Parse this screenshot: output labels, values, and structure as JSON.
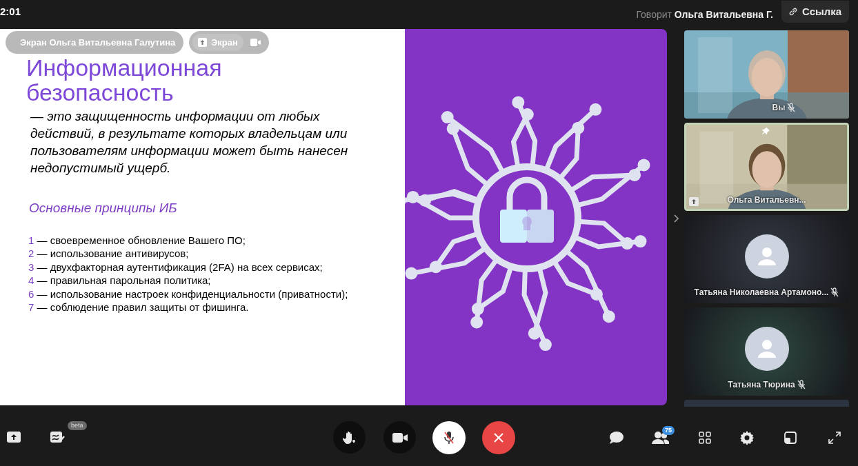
{
  "top_bar": {
    "time": "2:01",
    "speaker_label": "Говорит",
    "speaker_name": "Ольга Витальевна Г.",
    "link_button": "Ссылка"
  },
  "screen_share": {
    "overlay": {
      "pin_label": "Экран Ольга Витальевна Галутина",
      "screen_chip": "Экран"
    },
    "slide": {
      "title_lines": [
        "Информационная",
        "безопасность"
      ],
      "definition": "— это защищенность информации от любых действий, в результате которых владельцам или пользователям информации может быть нанесен недопустимый ущерб.",
      "principles_heading": "Основные принципы ИБ",
      "principles": [
        {
          "number": "1",
          "text": "— своевременное обновление Вашего ПО;"
        },
        {
          "number": "2",
          "text": "— использование антивирусов;"
        },
        {
          "number": "3",
          "text": "— двухфакторная аутентификация (2FA) на всех сервисах;"
        },
        {
          "number": "4",
          "text": "— правильная парольная политика;"
        },
        {
          "number": "6",
          "text": "— использование настроек конфиденциальности (приватности);"
        },
        {
          "number": "7",
          "text": "— соблюдение правил защиты от фишинга."
        }
      ]
    }
  },
  "participants": [
    {
      "kind": "video",
      "name": "Вы",
      "muted": true,
      "pinned": false,
      "sharing": false,
      "speaking": false
    },
    {
      "kind": "video",
      "name": "Ольга Витальевн...",
      "muted": false,
      "pinned": true,
      "sharing": true,
      "speaking": true
    },
    {
      "kind": "avatar",
      "name": "Татьяна Николаевна Артамоно...",
      "muted": true,
      "pinned": false,
      "sharing": false,
      "speaking": false
    },
    {
      "kind": "avatar",
      "name": "Татьяна Тюрина",
      "muted": true,
      "pinned": false,
      "sharing": false,
      "speaking": false
    },
    {
      "kind": "cut"
    }
  ],
  "toolbar": {
    "beta_badge": "beta",
    "participants_count": "75",
    "mic_muted": true
  }
}
